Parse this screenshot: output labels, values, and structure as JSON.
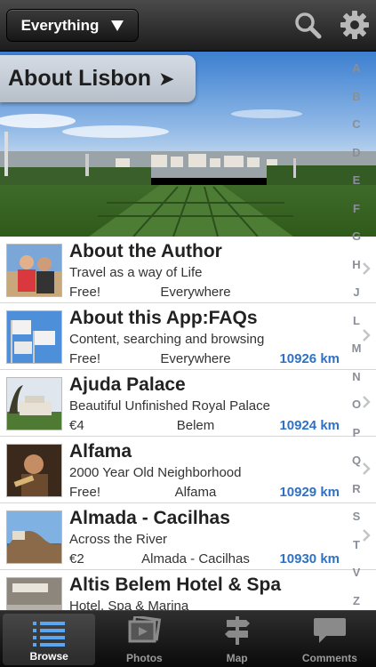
{
  "topbar": {
    "filter_label": "Everything",
    "search_icon": "search-icon",
    "settings_icon": "gear-icon"
  },
  "hero": {
    "title": "About Lisbon",
    "arrow": "➤"
  },
  "list": {
    "items": [
      {
        "title": "About the Author",
        "subtitle": "Travel as a way of Life",
        "price": "Free!",
        "location": "Everywhere",
        "distance": ""
      },
      {
        "title": "About this App:FAQs",
        "subtitle": "Content, searching and browsing",
        "price": "Free!",
        "location": "Everywhere",
        "distance": "10926 km"
      },
      {
        "title": "Ajuda Palace",
        "subtitle": "Beautiful Unfinished Royal Palace",
        "price": "€4",
        "location": "Belem",
        "distance": "10924 km"
      },
      {
        "title": "Alfama",
        "subtitle": " 2000 Year Old Neighborhood",
        "price": "Free!",
        "location": "Alfama",
        "distance": "10929 km"
      },
      {
        "title": "Almada - Cacilhas",
        "subtitle": "Across the River",
        "price": "€2",
        "location": "Almada - Cacilhas",
        "distance": "10930 km"
      },
      {
        "title": "Altis Belem Hotel & Spa",
        "subtitle": "Hotel, Spa & Marina",
        "price": "",
        "location": "",
        "distance": ""
      }
    ]
  },
  "index_letters": [
    "A",
    "B",
    "C",
    "D",
    "E",
    "F",
    "G",
    "H",
    "J",
    "L",
    "M",
    "N",
    "O",
    "P",
    "Q",
    "R",
    "S",
    "T",
    "V",
    "Z"
  ],
  "tabs": [
    {
      "label": "Browse",
      "icon": "list-icon",
      "active": true
    },
    {
      "label": "Photos",
      "icon": "photos-icon",
      "active": false
    },
    {
      "label": "Map",
      "icon": "signpost-icon",
      "active": false
    },
    {
      "label": "Comments",
      "icon": "speech-bubble-icon",
      "active": false
    }
  ],
  "colors": {
    "distance": "#2f72c3",
    "index": "#8a8f97"
  }
}
